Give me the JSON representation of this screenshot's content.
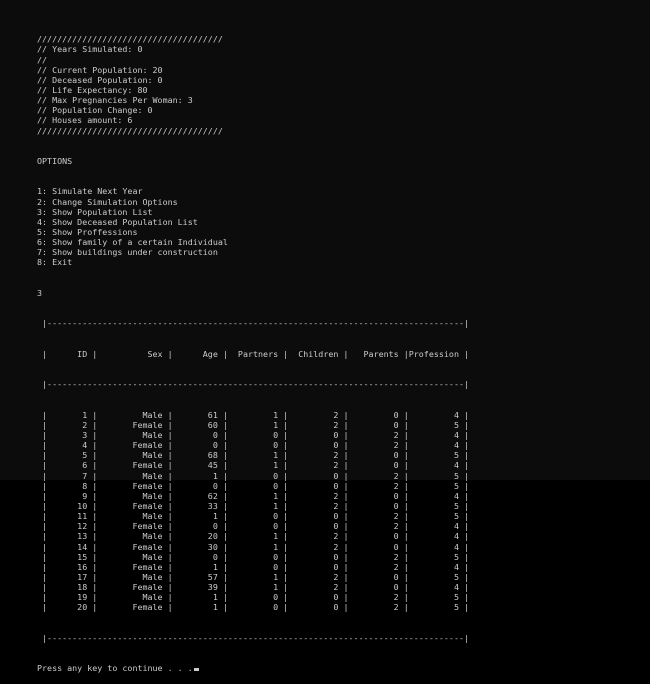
{
  "console": {
    "header": [
      "/////////////////////////////////////",
      "// Years Simulated: 0",
      "//",
      "// Current Population: 20",
      "// Deceased Population: 0",
      "// Life Expectancy: 80",
      "// Max Pregnancies Per Woman: 3",
      "// Population Change: 0",
      "// Houses amount: 6",
      "/////////////////////////////////////"
    ],
    "options_title": "OPTIONS",
    "options": [
      "1: Simulate Next Year",
      "2: Change Simulation Options",
      "3: Show Population List",
      "4: Show Deceased Population List",
      "5: Show Proffessions",
      "6: Show family of a certain Individual",
      "7: Show buildings under construction",
      "8: Exit"
    ],
    "input": "3",
    "table_top": " |-----------------------------------------------------------------------------------|",
    "table_header": " |      ID |          Sex |      Age |  Partners |  Children |   Parents |Profession |",
    "table_sep": " |-----------------------------------------------------------------------------------|",
    "table_columns": [
      "ID",
      "Sex",
      "Age",
      "Partners",
      "Children",
      "Parents",
      "Profession"
    ],
    "table_rows": [
      [
        "1",
        "Male",
        "61",
        "1",
        "2",
        "0",
        "4"
      ],
      [
        "2",
        "Female",
        "60",
        "1",
        "2",
        "0",
        "5"
      ],
      [
        "3",
        "Male",
        "0",
        "0",
        "0",
        "2",
        "4"
      ],
      [
        "4",
        "Female",
        "0",
        "0",
        "0",
        "2",
        "4"
      ],
      [
        "5",
        "Male",
        "68",
        "1",
        "2",
        "0",
        "5"
      ],
      [
        "6",
        "Female",
        "45",
        "1",
        "2",
        "0",
        "4"
      ],
      [
        "7",
        "Male",
        "1",
        "0",
        "0",
        "2",
        "5"
      ],
      [
        "8",
        "Female",
        "0",
        "0",
        "0",
        "2",
        "5"
      ],
      [
        "9",
        "Male",
        "62",
        "1",
        "2",
        "0",
        "4"
      ],
      [
        "10",
        "Female",
        "33",
        "1",
        "2",
        "0",
        "5"
      ],
      [
        "11",
        "Male",
        "1",
        "0",
        "0",
        "2",
        "5"
      ],
      [
        "12",
        "Female",
        "0",
        "0",
        "0",
        "2",
        "4"
      ],
      [
        "13",
        "Male",
        "20",
        "1",
        "2",
        "0",
        "4"
      ],
      [
        "14",
        "Female",
        "30",
        "1",
        "2",
        "0",
        "4"
      ],
      [
        "15",
        "Male",
        "0",
        "0",
        "0",
        "2",
        "5"
      ],
      [
        "16",
        "Female",
        "1",
        "0",
        "0",
        "2",
        "4"
      ],
      [
        "17",
        "Male",
        "57",
        "1",
        "2",
        "0",
        "5"
      ],
      [
        "18",
        "Female",
        "39",
        "1",
        "2",
        "0",
        "4"
      ],
      [
        "19",
        "Male",
        "1",
        "0",
        "0",
        "2",
        "5"
      ],
      [
        "20",
        "Female",
        "1",
        "0",
        "0",
        "2",
        "5"
      ]
    ],
    "table_bottom": " |-----------------------------------------------------------------------------------|",
    "prompt": "Press any key to continue . . ."
  }
}
